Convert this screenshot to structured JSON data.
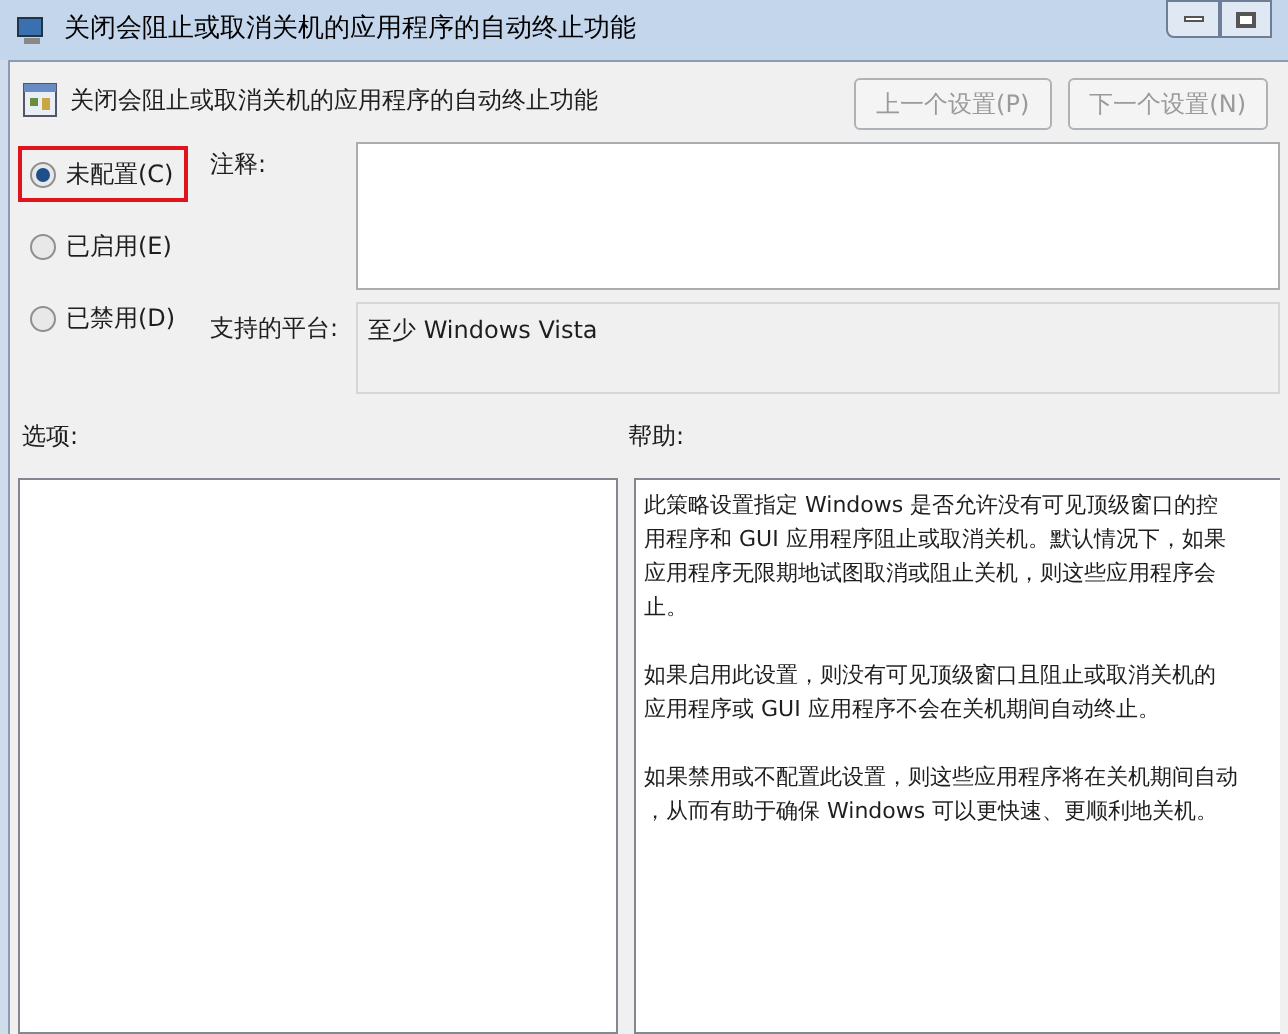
{
  "window": {
    "title": "关闭会阻止或取消关机的应用程序的自动终止功能"
  },
  "header": {
    "title": "关闭会阻止或取消关机的应用程序的自动终止功能",
    "buttons": [
      {
        "label": "上一个设置(P)",
        "disabled": true
      },
      {
        "label": "下一个设置(N)",
        "disabled": true
      }
    ]
  },
  "states": [
    {
      "label": "未配置(C)",
      "selected": true,
      "highlighted": true
    },
    {
      "label": "已启用(E)",
      "selected": false,
      "highlighted": false
    },
    {
      "label": "已禁用(D)",
      "selected": false,
      "highlighted": false
    }
  ],
  "comment": {
    "label": "注释:"
  },
  "platform": {
    "label": "支持的平台:",
    "value": "至少 Windows Vista"
  },
  "options": {
    "label": "选项:"
  },
  "help": {
    "label": "帮助:",
    "paragraphs": [
      [
        "此策略设置指定 Windows 是否允许没有可见顶级窗口的控",
        "用程序和 GUI 应用程序阻止或取消关机。默认情况下，如果",
        "应用程序无限期地试图取消或阻止关机，则这些应用程序会",
        "止。"
      ],
      [
        "如果启用此设置，则没有可见顶级窗口且阻止或取消关机的",
        "应用程序或 GUI 应用程序不会在关机期间自动终止。"
      ],
      [
        "如果禁用或不配置此设置，则这些应用程序将在关机期间自动",
        "，从而有助于确保 Windows 可以更快速、更顺利地关机。"
      ]
    ]
  }
}
